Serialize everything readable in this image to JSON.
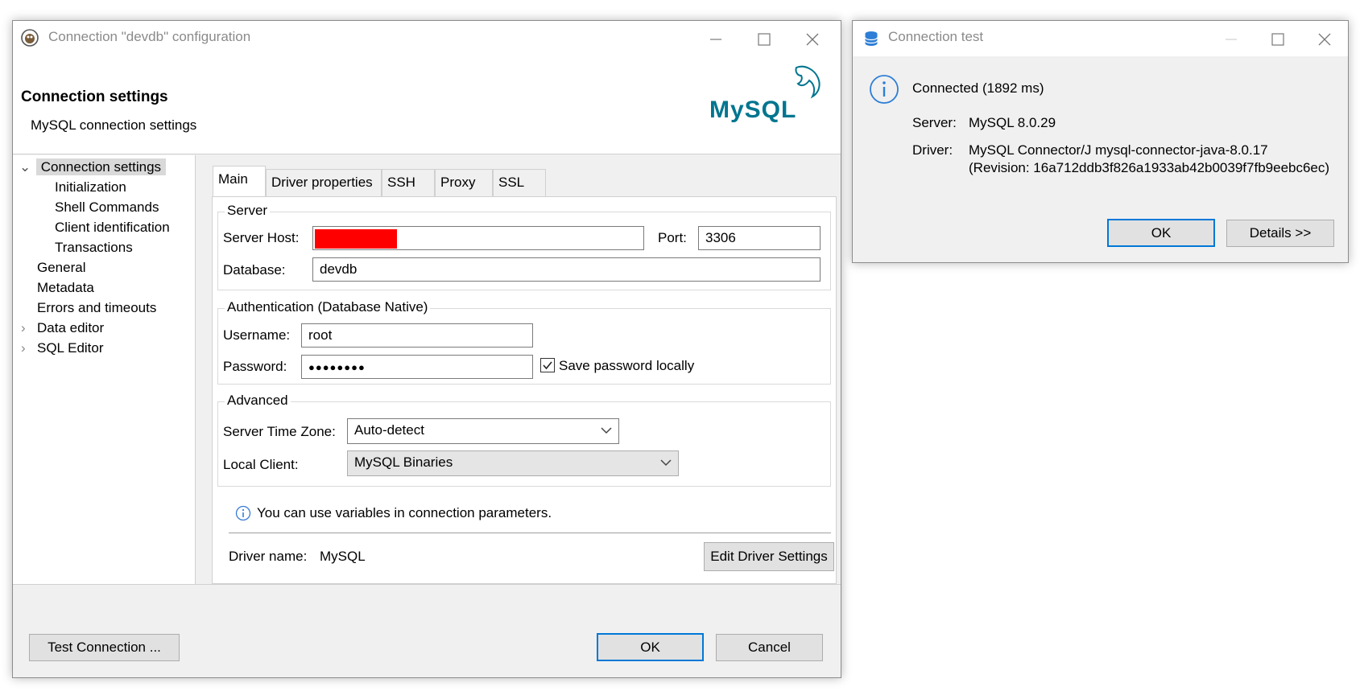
{
  "config_dialog": {
    "title": "Connection \"devdb\" configuration",
    "header_title": "Connection settings",
    "header_subtitle": "MySQL connection settings",
    "logo_text": "MySQL",
    "tree": {
      "items": [
        {
          "label": "Connection settings",
          "expander": "⌄"
        },
        {
          "label": "Initialization"
        },
        {
          "label": "Shell Commands"
        },
        {
          "label": "Client identification"
        },
        {
          "label": "Transactions"
        },
        {
          "label": "General"
        },
        {
          "label": "Metadata"
        },
        {
          "label": "Errors and timeouts"
        },
        {
          "label": "Data editor",
          "expander": "›"
        },
        {
          "label": "SQL Editor",
          "expander": "›"
        }
      ]
    },
    "tabs": [
      "Main",
      "Driver properties",
      "SSH",
      "Proxy",
      "SSL"
    ],
    "server_group": {
      "title": "Server",
      "host_label": "Server Host:",
      "host_value": "",
      "port_label": "Port:",
      "port_value": "3306",
      "database_label": "Database:",
      "database_value": "devdb"
    },
    "auth_group": {
      "title": "Authentication (Database Native)",
      "username_label": "Username:",
      "username_value": "root",
      "password_label": "Password:",
      "password_value": "●●●●●●●●",
      "save_password_label": "Save password locally",
      "save_password_checked": true
    },
    "advanced_group": {
      "title": "Advanced",
      "timezone_label": "Server Time Zone:",
      "timezone_value": "Auto-detect",
      "local_client_label": "Local Client:",
      "local_client_value": "MySQL Binaries"
    },
    "info_text": "You can use variables in connection parameters.",
    "driver_name_label": "Driver name:",
    "driver_name_value": "MySQL",
    "edit_driver_button": "Edit Driver Settings",
    "test_connection_button": "Test Connection ...",
    "ok_button": "OK",
    "cancel_button": "Cancel"
  },
  "test_dialog": {
    "title": "Connection test",
    "status": "Connected (1892 ms)",
    "server_label": "Server:",
    "server_value": "MySQL 8.0.29",
    "driver_label": "Driver:",
    "driver_value_line1": "MySQL Connector/J mysql-connector-java-8.0.17",
    "driver_value_line2": "(Revision: 16a712ddb3f826a1933ab42b0039f7fb9eebc6ec)",
    "ok_button": "OK",
    "details_button": "Details >>"
  },
  "colors": {
    "accent": "#0078d7",
    "redaction": "#ff0000",
    "mysql_blue": "#00758f",
    "mysql_orange": "#f29111"
  }
}
